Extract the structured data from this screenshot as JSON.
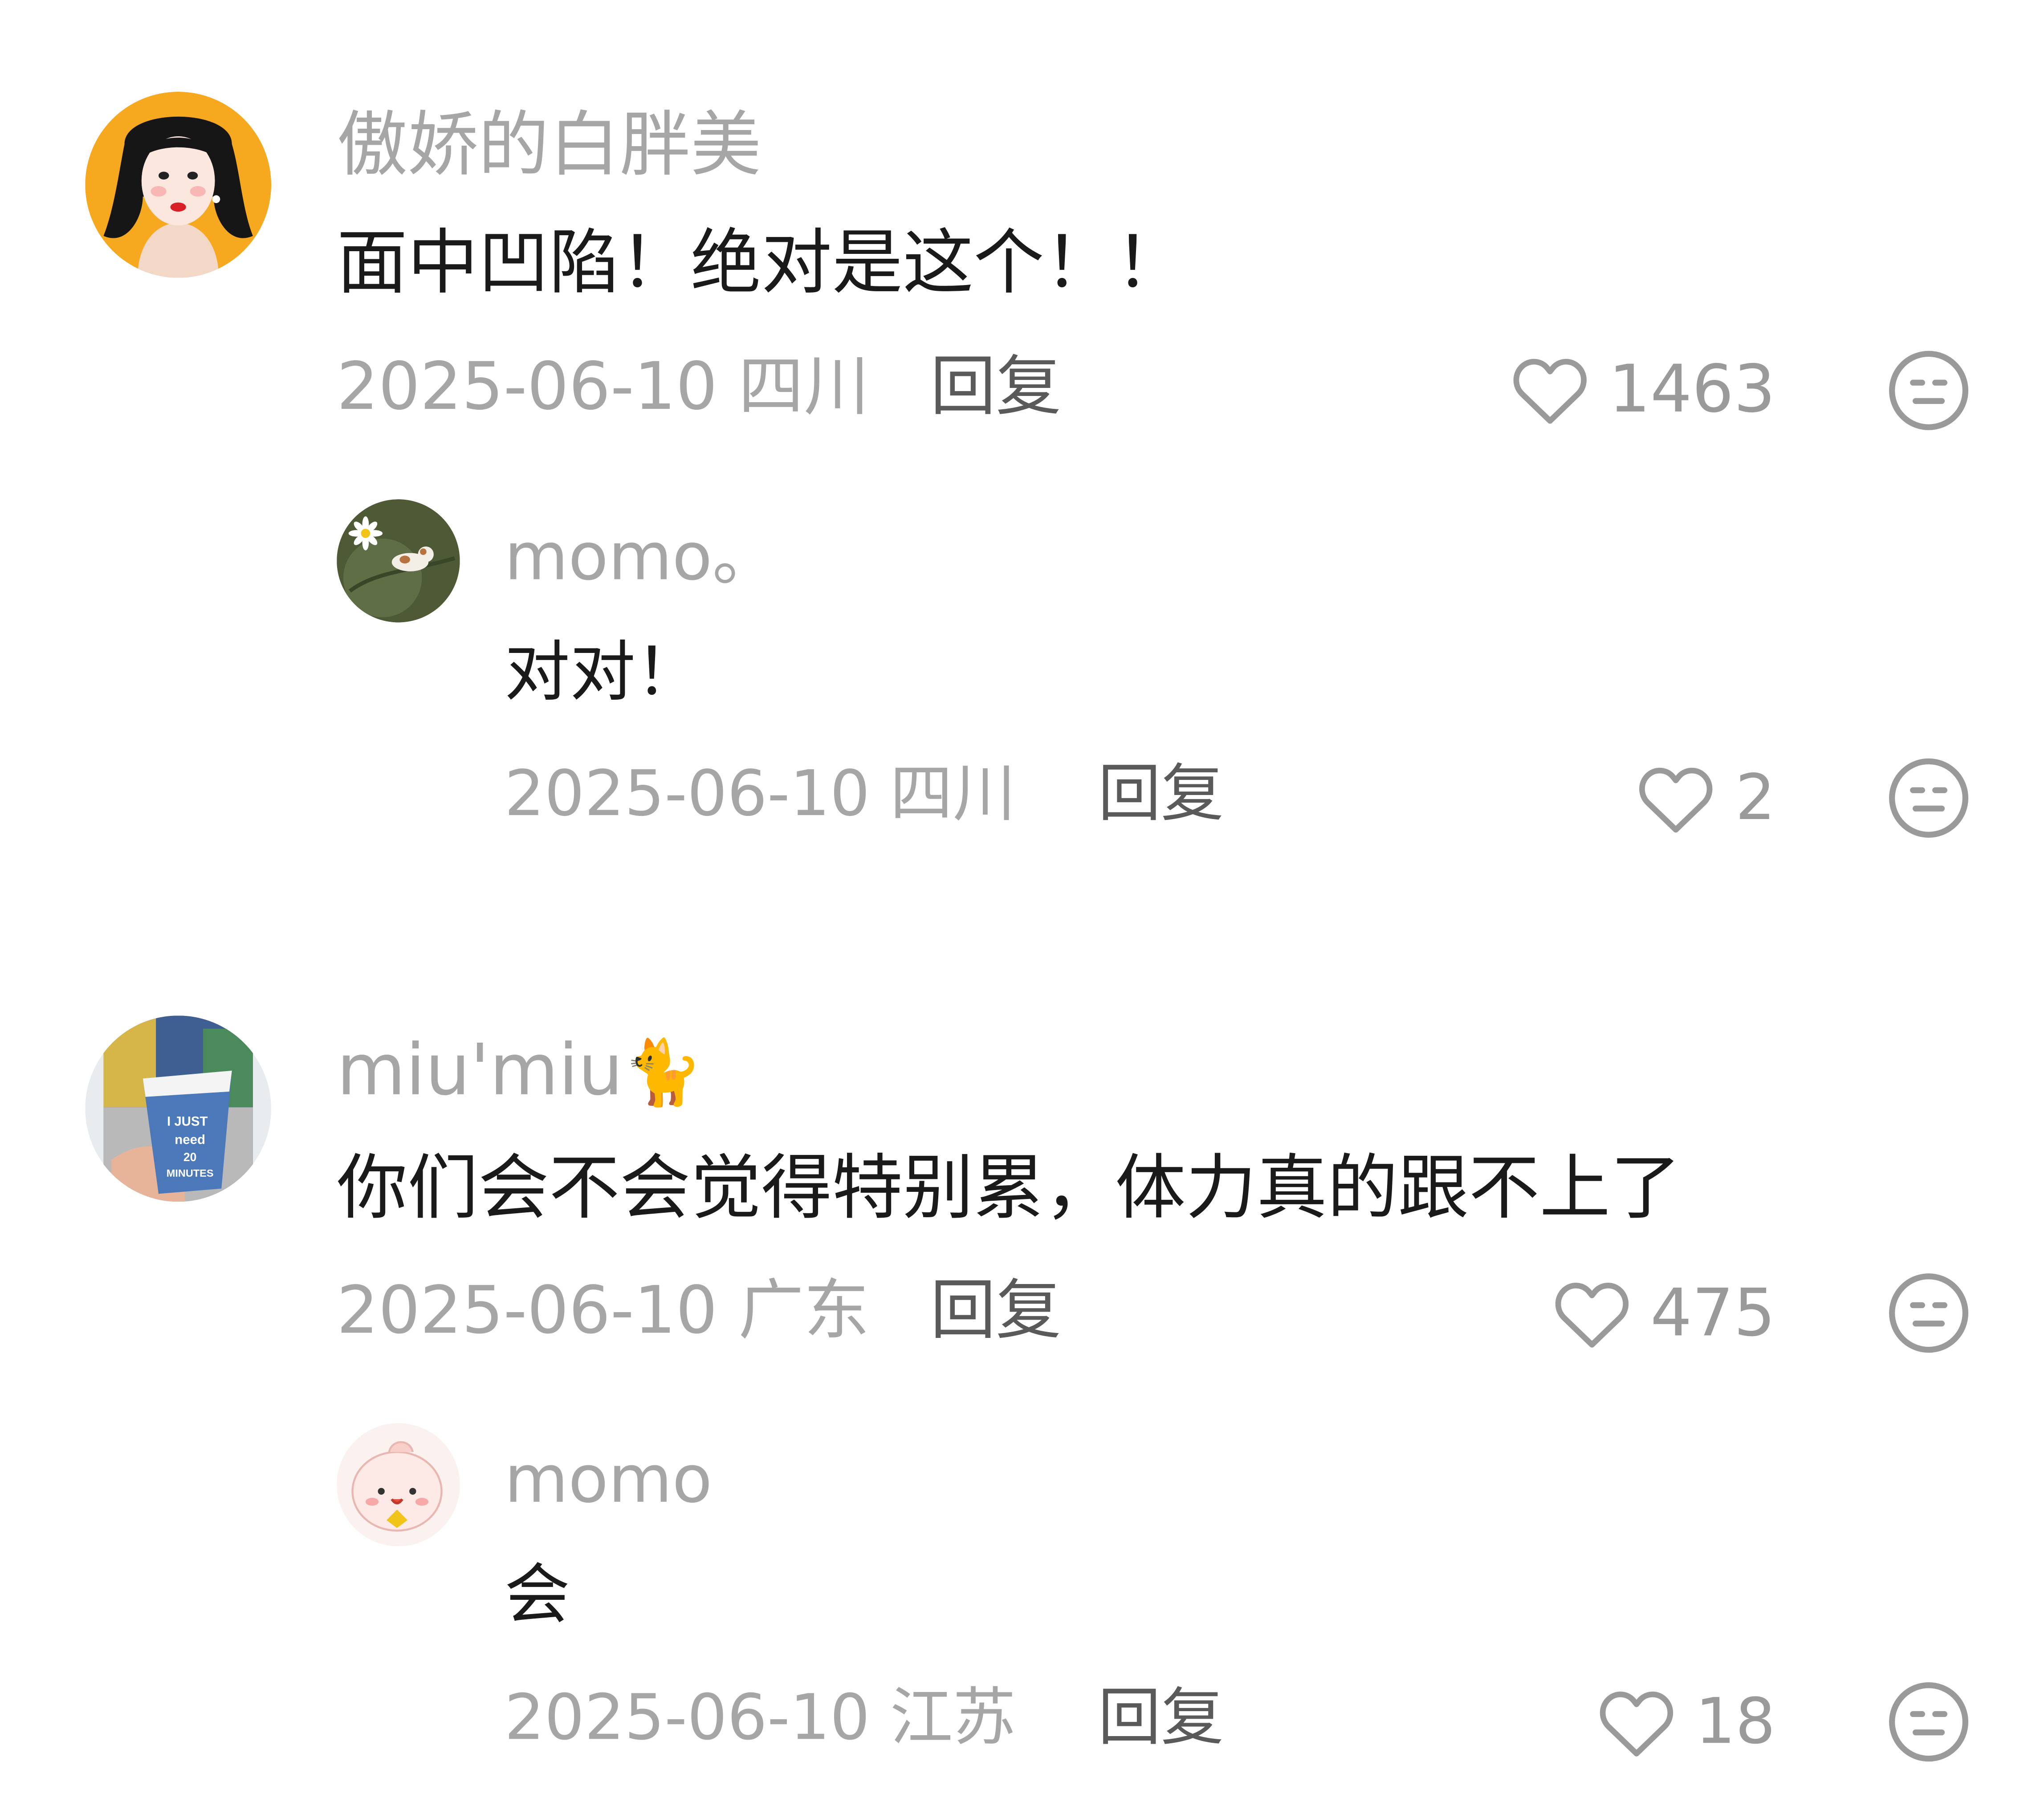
{
  "comments": [
    {
      "username": "傲娇的白胖美",
      "text": "面中凹陷！绝对是这个！！",
      "date": "2025-06-10",
      "location": "四川",
      "reply_label": "回复",
      "likes": "1463",
      "reply": {
        "username": "momo。",
        "text": "对对！",
        "date": "2025-06-10",
        "location": "四川",
        "reply_label": "回复",
        "likes": "2"
      }
    },
    {
      "username": "miu'miu",
      "username_emoji": "🐈",
      "text": "你们会不会觉得特别累，体力真的跟不上了",
      "date": "2025-06-10",
      "location": "广东",
      "reply_label": "回复",
      "likes": "475",
      "reply": {
        "username": "momo",
        "text": "会",
        "date": "2025-06-10",
        "location": "江苏",
        "reply_label": "回复",
        "likes": "18"
      }
    }
  ],
  "icons": {
    "like": "heart-outline-icon",
    "dislike": "neutral-face-icon"
  },
  "colors": {
    "username": "#a6a6a6",
    "body_text": "#1a1a1a",
    "meta": "#a6a6a6",
    "reply_link": "#5a5a5a",
    "icon": "#9a9a9a"
  }
}
